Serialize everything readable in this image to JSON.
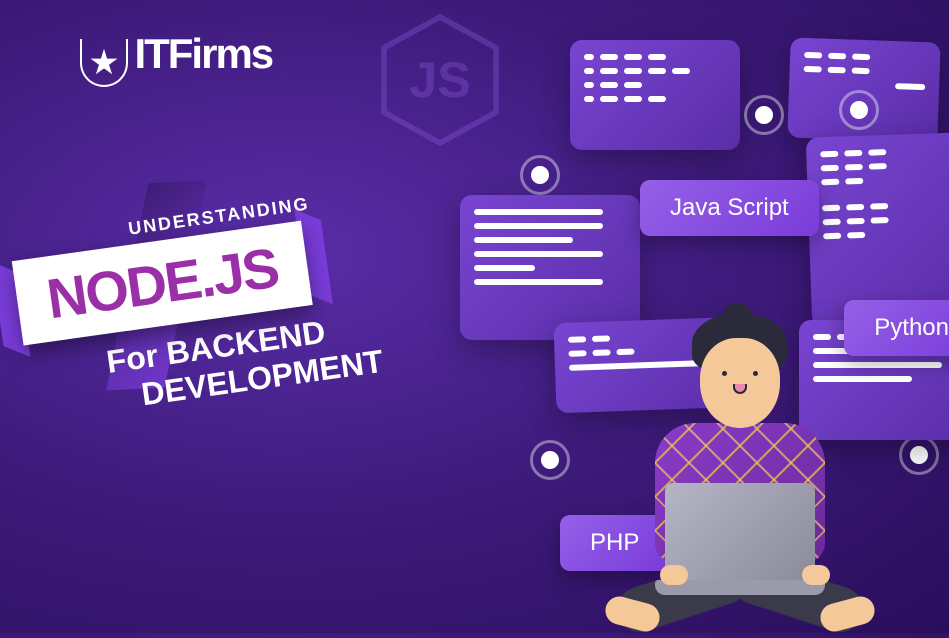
{
  "logo": {
    "brand": "ITFirms"
  },
  "title": {
    "line1": "UNDERSTANDING",
    "main": "NODE.JS",
    "line2": "For BACKEND",
    "line3": "DEVELOPMENT"
  },
  "languages": {
    "javascript": "Java Script",
    "python": "Python",
    "php": "PHP"
  },
  "watermark": "JS"
}
